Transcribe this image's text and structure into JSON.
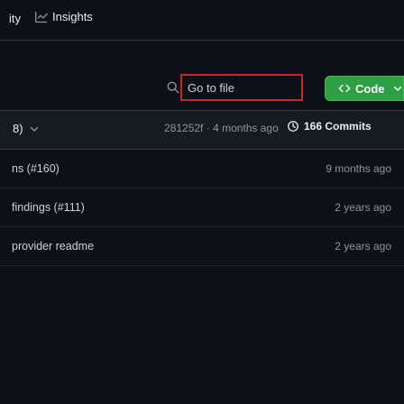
{
  "tabs": {
    "partial_label": "ity",
    "insights_label": "Insights",
    "insights_icon": "graph-icon"
  },
  "search": {
    "placeholder": "Go to file",
    "icon": "search-icon",
    "border_color": "#c62828"
  },
  "code_button": {
    "label": "Code",
    "icon": "code-icon",
    "color": "#2ea043"
  },
  "commit_bar": {
    "branch_partial": "8)",
    "hash": "281252f",
    "separator": " · ",
    "age": "4 months ago",
    "commits_label": "166 Commits"
  },
  "files": [
    {
      "name": "ns (#160)",
      "age": "9 months ago"
    },
    {
      "name": "findings (#111)",
      "age": "2 years ago"
    },
    {
      "name": "provider readme",
      "age": "2 years ago"
    }
  ]
}
